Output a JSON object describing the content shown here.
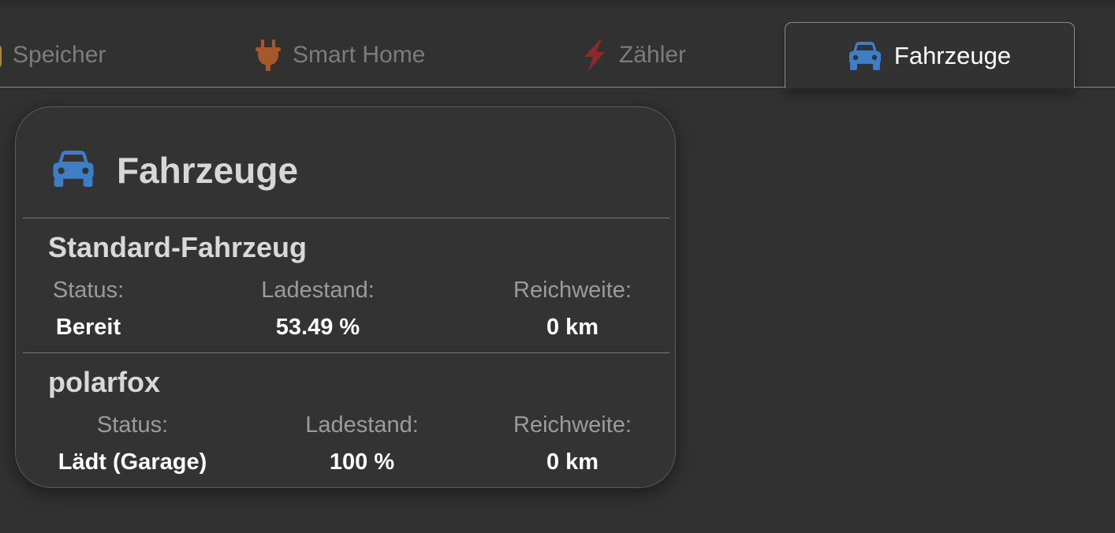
{
  "colors": {
    "background": "#313131",
    "card_background": "#333333",
    "car_icon": "#3f7ec4",
    "plug_icon": "#a5582a",
    "bolt_icon": "#8a2b2b",
    "battery_icon": "#a8873a",
    "active_tab_text": "#ffffff",
    "inactive_tab_text": "#7c7c7c"
  },
  "tabs": [
    {
      "label": "Speicher",
      "icon": "battery-icon",
      "active": false
    },
    {
      "label": "Smart Home",
      "icon": "plug-icon",
      "active": false
    },
    {
      "label": "Zähler",
      "icon": "bolt-icon",
      "active": false
    },
    {
      "label": "Fahrzeuge",
      "icon": "car-icon",
      "active": true
    }
  ],
  "card": {
    "title": "Fahrzeuge",
    "icon": "car-icon",
    "vehicles": [
      {
        "name": "Standard-Fahrzeug",
        "status_label": "Status:",
        "status": "Bereit",
        "soc_label": "Ladestand:",
        "soc": "53.49 %",
        "range_label": "Reichweite:",
        "range": "0 km"
      },
      {
        "name": "polarfox",
        "status_label": "Status:",
        "status": "Lädt (Garage)",
        "soc_label": "Ladestand:",
        "soc": "100 %",
        "range_label": "Reichweite:",
        "range": "0 km"
      }
    ]
  }
}
